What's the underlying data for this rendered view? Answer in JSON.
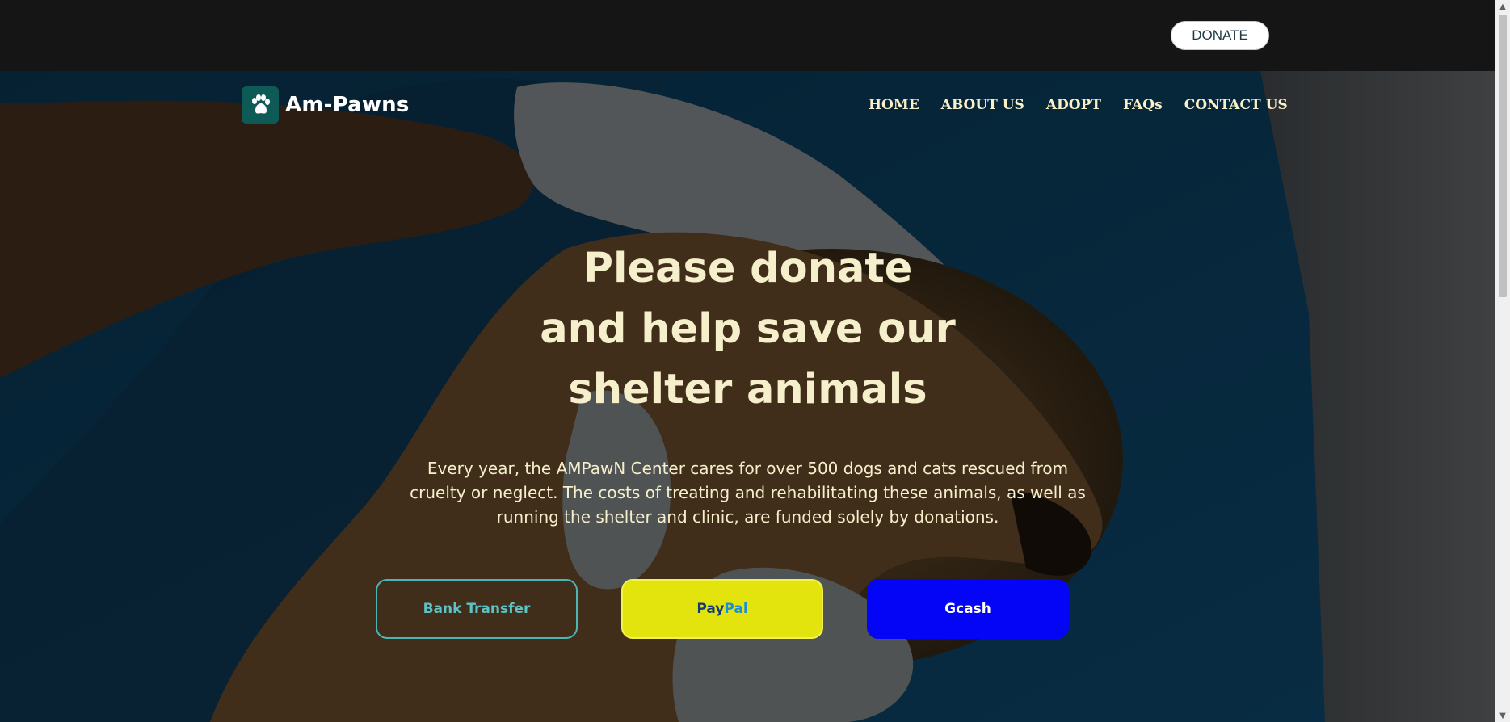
{
  "topbar": {
    "donate_label": "DONATE"
  },
  "brand": {
    "name": "Am-Pawns",
    "logo_icon": "paw-icon"
  },
  "nav": {
    "items": [
      {
        "label": "HOME"
      },
      {
        "label": "ABOUT US"
      },
      {
        "label": "ADOPT"
      },
      {
        "label": "FAQs"
      },
      {
        "label": "CONTACT US"
      }
    ]
  },
  "hero": {
    "headline_lines": [
      "Please donate",
      "and help save our",
      "shelter animals"
    ],
    "lead": "Every year, the AMPawN Center cares for over 500 dogs and cats rescued from cruelty or neglect. The costs of treating and rehabilitating these animals, as well as running the shelter and clinic, are funded solely by donations.",
    "background_image": "veterinarian-holding-dog-head"
  },
  "payment": {
    "bank_label": "Bank Transfer",
    "paypal_label_a": "Pay",
    "paypal_label_b": "Pal",
    "gcash_label": "Gcash"
  },
  "colors": {
    "topbar": "#151515",
    "headline": "#f6efcb",
    "paypal_bg": "#e3e30e",
    "gcash_bg": "#0404f6",
    "bank_border": "#4fb4b4",
    "logo_bg": "#0d5a57"
  }
}
